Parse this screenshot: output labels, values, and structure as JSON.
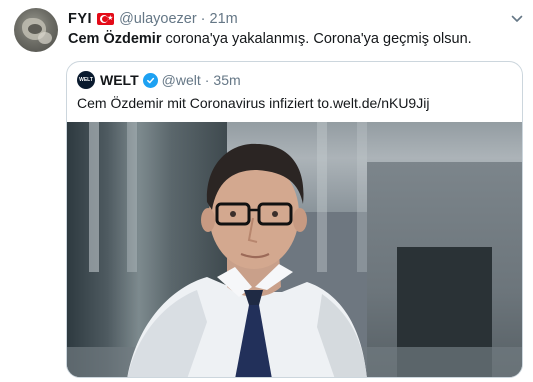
{
  "tweet": {
    "display_name": "FYI",
    "flag_icon": "turkey-flag-icon",
    "handle": "@ulayoezer",
    "separator": "·",
    "time": "21m",
    "text_bold": "Cem Özdemir",
    "text_rest": " corona'ya yakalanmış. Corona'ya geçmiş olsun."
  },
  "quote": {
    "logo_text": "WELT",
    "name": "WELT",
    "handle": "@welt",
    "separator": "·",
    "time": "35m",
    "text": "Cem Özdemir mit Coronavirus infiziert to.welt.de/nKU9Jij"
  },
  "colors": {
    "text_primary": "#14171a",
    "text_secondary": "#657786",
    "verified_blue": "#1da1f2",
    "border": "#ccd6dd",
    "flag_red": "#e30a17"
  }
}
